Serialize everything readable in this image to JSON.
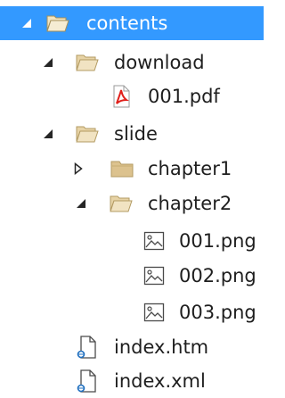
{
  "tree": {
    "nodes": [
      {
        "id": "contents",
        "label": "contents",
        "type": "folder",
        "state": "expanded",
        "selected": true
      },
      {
        "id": "download",
        "label": "download",
        "type": "folder",
        "state": "expanded"
      },
      {
        "id": "001-pdf",
        "label": "001.pdf",
        "type": "pdf-file"
      },
      {
        "id": "slide",
        "label": "slide",
        "type": "folder",
        "state": "expanded"
      },
      {
        "id": "chapter1",
        "label": "chapter1",
        "type": "folder",
        "state": "collapsed"
      },
      {
        "id": "chapter2",
        "label": "chapter2",
        "type": "folder",
        "state": "expanded"
      },
      {
        "id": "001-png",
        "label": "001.png",
        "type": "image-file"
      },
      {
        "id": "002-png",
        "label": "002.png",
        "type": "image-file"
      },
      {
        "id": "003-png",
        "label": "003.png",
        "type": "image-file"
      },
      {
        "id": "index-htm",
        "label": "index.htm",
        "type": "web-file"
      },
      {
        "id": "index-xml",
        "label": "index.xml",
        "type": "web-file"
      }
    ],
    "colors": {
      "selection": "#3399ff",
      "folder": "#dcc28e",
      "pdf": "#e0201b"
    },
    "icons": {
      "expanded": "triangle-filled-down-right-icon",
      "collapsed": "triangle-hollow-right-icon",
      "open-folder": "open-folder-icon",
      "closed-folder": "closed-folder-icon",
      "pdf-file": "pdf-file-icon",
      "image-file": "image-file-icon",
      "web-file": "web-document-icon"
    }
  }
}
